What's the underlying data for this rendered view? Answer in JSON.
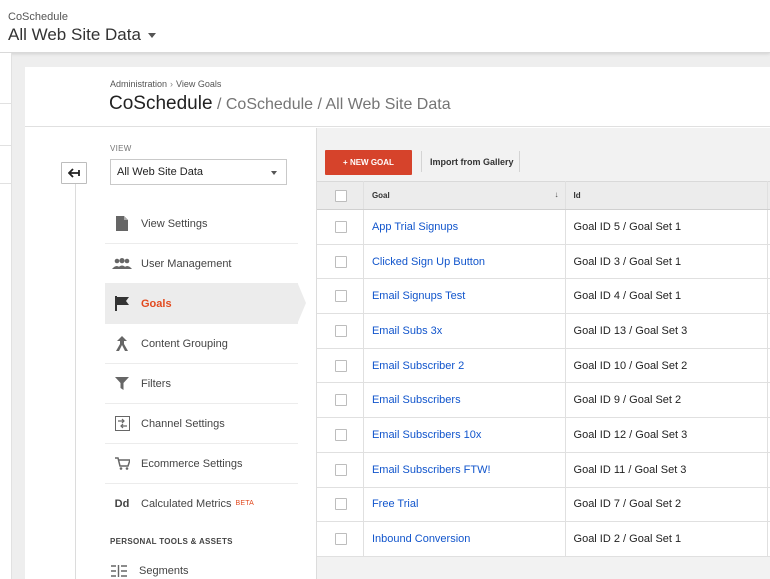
{
  "header": {
    "account": "CoSchedule",
    "property": "All Web Site Data"
  },
  "breadcrumb": {
    "items": [
      "Administration",
      "View Goals"
    ],
    "separator": "›"
  },
  "page_title": {
    "main": "CoSchedule",
    "sub": " / CoSchedule / All Web Site Data"
  },
  "view": {
    "label": "VIEW",
    "selected": "All Web Site Data"
  },
  "menu": {
    "items": [
      {
        "label": "View Settings",
        "icon": "document-icon"
      },
      {
        "label": "User Management",
        "icon": "users-icon"
      },
      {
        "label": "Goals",
        "icon": "flag-icon",
        "active": true
      },
      {
        "label": "Content Grouping",
        "icon": "content-grouping-icon"
      },
      {
        "label": "Filters",
        "icon": "filter-icon"
      },
      {
        "label": "Channel Settings",
        "icon": "channel-settings-icon"
      },
      {
        "label": "Ecommerce Settings",
        "icon": "cart-icon"
      },
      {
        "label": "Calculated Metrics",
        "icon": "calculated-metrics-icon",
        "badge": "BETA"
      }
    ],
    "section_heading": "PERSONAL TOOLS & ASSETS",
    "segments_label": "Segments"
  },
  "toolbar": {
    "new_goal": "+ NEW GOAL",
    "import": "Import from Gallery"
  },
  "table": {
    "columns": [
      "Goal",
      "Id"
    ],
    "rows": [
      {
        "goal": "App Trial Signups",
        "id": "Goal ID 5 / Goal Set 1"
      },
      {
        "goal": "Clicked Sign Up Button",
        "id": "Goal ID 3 / Goal Set 1"
      },
      {
        "goal": "Email Signups Test",
        "id": "Goal ID 4 / Goal Set 1"
      },
      {
        "goal": "Email Subs 3x",
        "id": "Goal ID 13 / Goal Set 3"
      },
      {
        "goal": "Email Subscriber 2",
        "id": "Goal ID 10 / Goal Set 2"
      },
      {
        "goal": "Email Subscribers",
        "id": "Goal ID 9 / Goal Set 2"
      },
      {
        "goal": "Email Subscribers 10x",
        "id": "Goal ID 12 / Goal Set 3"
      },
      {
        "goal": "Email Subscribers FTW!",
        "id": "Goal ID 11 / Goal Set 3"
      },
      {
        "goal": "Free Trial",
        "id": "Goal ID 7 / Goal Set 2"
      },
      {
        "goal": "Inbound Conversion",
        "id": "Goal ID 2 / Goal Set 1"
      }
    ]
  },
  "colors": {
    "accent": "#e24a1f",
    "button": "#d6432b",
    "link": "#1155cc"
  }
}
